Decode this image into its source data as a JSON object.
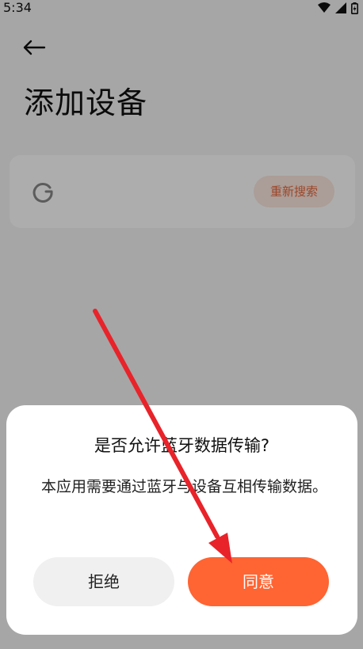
{
  "status_bar": {
    "time": "5:34",
    "icons": [
      "wifi-icon",
      "cell-signal-icon",
      "battery-icon"
    ]
  },
  "header": {
    "back_icon": "arrow-left-icon",
    "title": "添加设备"
  },
  "device_search": {
    "spinner_icon": "loading-spinner-icon",
    "rescan_label": "重新搜索"
  },
  "dialog": {
    "title": "是否允许蓝牙数据传输?",
    "message": "本应用需要通过蓝牙与设备互相传输数据。",
    "deny_label": "拒绝",
    "agree_label": "同意"
  },
  "annotation": {
    "icon": "red-pointer-arrow-icon",
    "color": "#e8232a"
  },
  "colors": {
    "accent": "#ff6433",
    "accent_light": "#fde8df",
    "scrim": "rgba(0,0,0,0.32)"
  }
}
